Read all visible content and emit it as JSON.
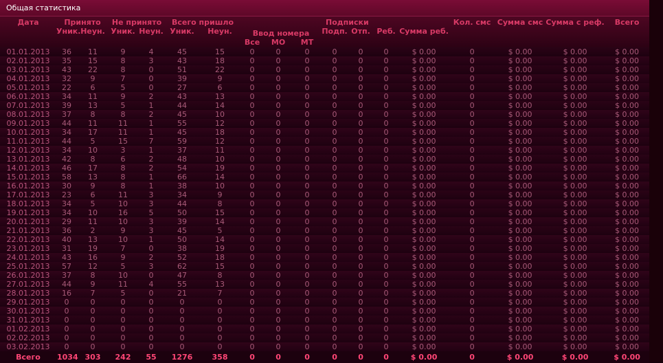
{
  "title": "Общая статистика",
  "header": {
    "date": "Дата",
    "accepted": "Принято",
    "not_accepted": "Не принято",
    "total_came": "Всего пришло",
    "uniq": "Уник.",
    "nonuniq": "Неун.",
    "number_input": "Ввод номера",
    "all": "Все",
    "mo": "МО",
    "mt": "МТ",
    "subscriptions": "Подписки",
    "subscr": "Подп.",
    "unsub": "Отп.",
    "rebill": "Реб.",
    "rebill_sum": "Сумма реб.",
    "sms_count": "Кол. смс",
    "sms_sum": "Сумма смс",
    "ref_sum": "Сумма с реф.",
    "total": "Всего"
  },
  "table": {
    "rows": [
      [
        "01.01.2013",
        "36",
        "11",
        "9",
        "4",
        "45",
        "15",
        "0",
        "0",
        "0",
        "0",
        "0",
        "0",
        "$ 0.00",
        "0",
        "$ 0.00",
        "$ 0.00",
        "$ 0.00"
      ],
      [
        "02.01.2013",
        "35",
        "15",
        "8",
        "3",
        "43",
        "18",
        "0",
        "0",
        "0",
        "0",
        "0",
        "0",
        "$ 0.00",
        "0",
        "$ 0.00",
        "$ 0.00",
        "$ 0.00"
      ],
      [
        "03.01.2013",
        "43",
        "22",
        "8",
        "0",
        "51",
        "22",
        "0",
        "0",
        "0",
        "0",
        "0",
        "0",
        "$ 0.00",
        "0",
        "$ 0.00",
        "$ 0.00",
        "$ 0.00"
      ],
      [
        "04.01.2013",
        "32",
        "9",
        "7",
        "0",
        "39",
        "9",
        "0",
        "0",
        "0",
        "0",
        "0",
        "0",
        "$ 0.00",
        "0",
        "$ 0.00",
        "$ 0.00",
        "$ 0.00"
      ],
      [
        "05.01.2013",
        "22",
        "6",
        "5",
        "0",
        "27",
        "6",
        "0",
        "0",
        "0",
        "0",
        "0",
        "0",
        "$ 0.00",
        "0",
        "$ 0.00",
        "$ 0.00",
        "$ 0.00"
      ],
      [
        "06.01.2013",
        "34",
        "11",
        "9",
        "2",
        "43",
        "13",
        "0",
        "0",
        "0",
        "0",
        "0",
        "0",
        "$ 0.00",
        "0",
        "$ 0.00",
        "$ 0.00",
        "$ 0.00"
      ],
      [
        "07.01.2013",
        "39",
        "13",
        "5",
        "1",
        "44",
        "14",
        "0",
        "0",
        "0",
        "0",
        "0",
        "0",
        "$ 0.00",
        "0",
        "$ 0.00",
        "$ 0.00",
        "$ 0.00"
      ],
      [
        "08.01.2013",
        "37",
        "8",
        "8",
        "2",
        "45",
        "10",
        "0",
        "0",
        "0",
        "0",
        "0",
        "0",
        "$ 0.00",
        "0",
        "$ 0.00",
        "$ 0.00",
        "$ 0.00"
      ],
      [
        "09.01.2013",
        "44",
        "11",
        "11",
        "1",
        "55",
        "12",
        "0",
        "0",
        "0",
        "0",
        "0",
        "0",
        "$ 0.00",
        "0",
        "$ 0.00",
        "$ 0.00",
        "$ 0.00"
      ],
      [
        "10.01.2013",
        "34",
        "17",
        "11",
        "1",
        "45",
        "18",
        "0",
        "0",
        "0",
        "0",
        "0",
        "0",
        "$ 0.00",
        "0",
        "$ 0.00",
        "$ 0.00",
        "$ 0.00"
      ],
      [
        "11.01.2013",
        "44",
        "5",
        "15",
        "7",
        "59",
        "12",
        "0",
        "0",
        "0",
        "0",
        "0",
        "0",
        "$ 0.00",
        "0",
        "$ 0.00",
        "$ 0.00",
        "$ 0.00"
      ],
      [
        "12.01.2013",
        "34",
        "10",
        "3",
        "1",
        "37",
        "11",
        "0",
        "0",
        "0",
        "0",
        "0",
        "0",
        "$ 0.00",
        "0",
        "$ 0.00",
        "$ 0.00",
        "$ 0.00"
      ],
      [
        "13.01.2013",
        "42",
        "8",
        "6",
        "2",
        "48",
        "10",
        "0",
        "0",
        "0",
        "0",
        "0",
        "0",
        "$ 0.00",
        "0",
        "$ 0.00",
        "$ 0.00",
        "$ 0.00"
      ],
      [
        "14.01.2013",
        "46",
        "17",
        "8",
        "2",
        "54",
        "19",
        "0",
        "0",
        "0",
        "0",
        "0",
        "0",
        "$ 0.00",
        "0",
        "$ 0.00",
        "$ 0.00",
        "$ 0.00"
      ],
      [
        "15.01.2013",
        "58",
        "13",
        "8",
        "1",
        "66",
        "14",
        "0",
        "0",
        "0",
        "0",
        "0",
        "0",
        "$ 0.00",
        "0",
        "$ 0.00",
        "$ 0.00",
        "$ 0.00"
      ],
      [
        "16.01.2013",
        "30",
        "9",
        "8",
        "1",
        "38",
        "10",
        "0",
        "0",
        "0",
        "0",
        "0",
        "0",
        "$ 0.00",
        "0",
        "$ 0.00",
        "$ 0.00",
        "$ 0.00"
      ],
      [
        "17.01.2013",
        "23",
        "6",
        "11",
        "3",
        "34",
        "9",
        "0",
        "0",
        "0",
        "0",
        "0",
        "0",
        "$ 0.00",
        "0",
        "$ 0.00",
        "$ 0.00",
        "$ 0.00"
      ],
      [
        "18.01.2013",
        "34",
        "5",
        "10",
        "3",
        "44",
        "8",
        "0",
        "0",
        "0",
        "0",
        "0",
        "0",
        "$ 0.00",
        "0",
        "$ 0.00",
        "$ 0.00",
        "$ 0.00"
      ],
      [
        "19.01.2013",
        "34",
        "10",
        "16",
        "5",
        "50",
        "15",
        "0",
        "0",
        "0",
        "0",
        "0",
        "0",
        "$ 0.00",
        "0",
        "$ 0.00",
        "$ 0.00",
        "$ 0.00"
      ],
      [
        "20.01.2013",
        "29",
        "11",
        "10",
        "3",
        "39",
        "14",
        "0",
        "0",
        "0",
        "0",
        "0",
        "0",
        "$ 0.00",
        "0",
        "$ 0.00",
        "$ 0.00",
        "$ 0.00"
      ],
      [
        "21.01.2013",
        "36",
        "2",
        "9",
        "3",
        "45",
        "5",
        "0",
        "0",
        "0",
        "0",
        "0",
        "0",
        "$ 0.00",
        "0",
        "$ 0.00",
        "$ 0.00",
        "$ 0.00"
      ],
      [
        "22.01.2013",
        "40",
        "13",
        "10",
        "1",
        "50",
        "14",
        "0",
        "0",
        "0",
        "0",
        "0",
        "0",
        "$ 0.00",
        "0",
        "$ 0.00",
        "$ 0.00",
        "$ 0.00"
      ],
      [
        "23.01.2013",
        "31",
        "19",
        "7",
        "0",
        "38",
        "19",
        "0",
        "0",
        "0",
        "0",
        "0",
        "0",
        "$ 0.00",
        "0",
        "$ 0.00",
        "$ 0.00",
        "$ 0.00"
      ],
      [
        "24.01.2013",
        "43",
        "16",
        "9",
        "2",
        "52",
        "18",
        "0",
        "0",
        "0",
        "0",
        "0",
        "0",
        "$ 0.00",
        "0",
        "$ 0.00",
        "$ 0.00",
        "$ 0.00"
      ],
      [
        "25.01.2013",
        "57",
        "12",
        "5",
        "3",
        "62",
        "15",
        "0",
        "0",
        "0",
        "0",
        "0",
        "0",
        "$ 0.00",
        "0",
        "$ 0.00",
        "$ 0.00",
        "$ 0.00"
      ],
      [
        "26.01.2013",
        "37",
        "8",
        "10",
        "0",
        "47",
        "8",
        "0",
        "0",
        "0",
        "0",
        "0",
        "0",
        "$ 0.00",
        "0",
        "$ 0.00",
        "$ 0.00",
        "$ 0.00"
      ],
      [
        "27.01.2013",
        "44",
        "9",
        "11",
        "4",
        "55",
        "13",
        "0",
        "0",
        "0",
        "0",
        "0",
        "0",
        "$ 0.00",
        "0",
        "$ 0.00",
        "$ 0.00",
        "$ 0.00"
      ],
      [
        "28.01.2013",
        "16",
        "7",
        "5",
        "0",
        "21",
        "7",
        "0",
        "0",
        "0",
        "0",
        "0",
        "0",
        "$ 0.00",
        "0",
        "$ 0.00",
        "$ 0.00",
        "$ 0.00"
      ],
      [
        "29.01.2013",
        "0",
        "0",
        "0",
        "0",
        "0",
        "0",
        "0",
        "0",
        "0",
        "0",
        "0",
        "0",
        "$ 0.00",
        "0",
        "$ 0.00",
        "$ 0.00",
        "$ 0.00"
      ],
      [
        "30.01.2013",
        "0",
        "0",
        "0",
        "0",
        "0",
        "0",
        "0",
        "0",
        "0",
        "0",
        "0",
        "0",
        "$ 0.00",
        "0",
        "$ 0.00",
        "$ 0.00",
        "$ 0.00"
      ],
      [
        "31.01.2013",
        "0",
        "0",
        "0",
        "0",
        "0",
        "0",
        "0",
        "0",
        "0",
        "0",
        "0",
        "0",
        "$ 0.00",
        "0",
        "$ 0.00",
        "$ 0.00",
        "$ 0.00"
      ],
      [
        "01.02.2013",
        "0",
        "0",
        "0",
        "0",
        "0",
        "0",
        "0",
        "0",
        "0",
        "0",
        "0",
        "0",
        "$ 0.00",
        "0",
        "$ 0.00",
        "$ 0.00",
        "$ 0.00"
      ],
      [
        "02.02.2013",
        "0",
        "0",
        "0",
        "0",
        "0",
        "0",
        "0",
        "0",
        "0",
        "0",
        "0",
        "0",
        "$ 0.00",
        "0",
        "$ 0.00",
        "$ 0.00",
        "$ 0.00"
      ],
      [
        "03.02.2013",
        "0",
        "0",
        "0",
        "0",
        "0",
        "0",
        "0",
        "0",
        "0",
        "0",
        "0",
        "0",
        "$ 0.00",
        "0",
        "$ 0.00",
        "$ 0.00",
        "$ 0.00"
      ]
    ],
    "totals": [
      "Всего",
      "1034",
      "303",
      "242",
      "55",
      "1276",
      "358",
      "0",
      "0",
      "0",
      "0",
      "0",
      "0",
      "$ 0.00",
      "0",
      "$ 0.00",
      "$ 0.00",
      "$ 0.00"
    ]
  }
}
